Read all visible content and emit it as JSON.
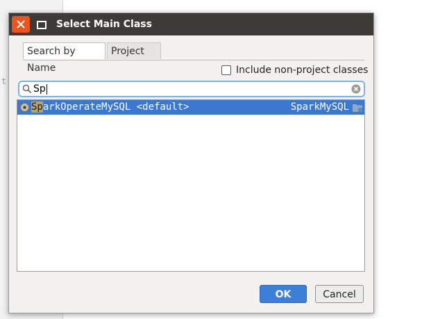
{
  "background": {
    "gutter_text": "t"
  },
  "dialog": {
    "title": "Select Main Class",
    "window_controls": {
      "close_icon": "close-icon",
      "maximize_icon": "maximize-icon"
    },
    "tabs": [
      {
        "label": "Search by Name",
        "active": true
      },
      {
        "label": "Project",
        "active": false
      }
    ],
    "include_non_project": {
      "label": "Include non-project classes",
      "checked": false
    },
    "search": {
      "value": "Sp"
    },
    "results": [
      {
        "match": "Sp",
        "rest": "arkOperateMySQL <default>",
        "module": "SparkMySQL",
        "selected": true
      }
    ],
    "buttons": {
      "ok": "OK",
      "cancel": "Cancel"
    },
    "colors": {
      "accent": "#e95420",
      "selection": "#3d78d0",
      "ok_button": "#3d7fd6",
      "match_highlight": "#b8a36b"
    }
  }
}
